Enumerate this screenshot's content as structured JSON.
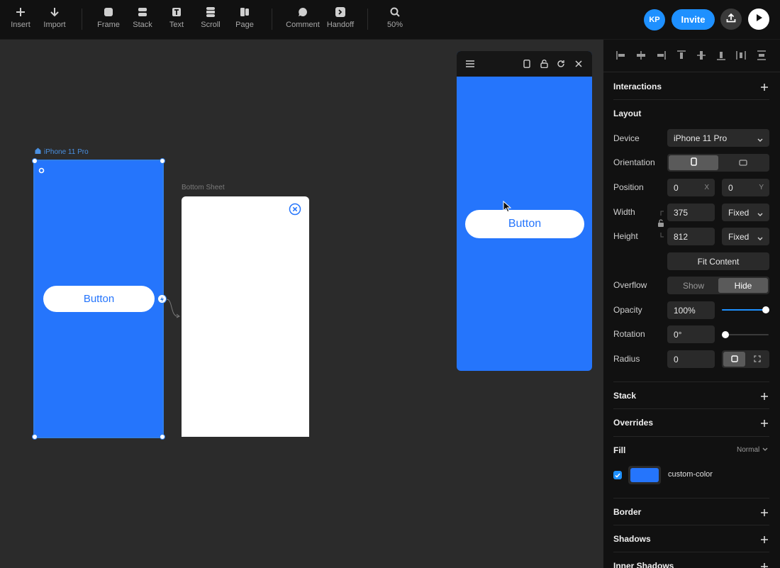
{
  "toolbar": {
    "tools": [
      {
        "label": "Insert",
        "icon": "plus-icon"
      },
      {
        "label": "Import",
        "icon": "arrow-down-icon"
      },
      {
        "label": "Frame",
        "icon": "frame-icon"
      },
      {
        "label": "Stack",
        "icon": "stack-icon"
      },
      {
        "label": "Text",
        "icon": "text-icon"
      },
      {
        "label": "Scroll",
        "icon": "scroll-icon"
      },
      {
        "label": "Page",
        "icon": "page-icon"
      },
      {
        "label": "Comment",
        "icon": "comment-icon"
      },
      {
        "label": "Handoff",
        "icon": "handoff-icon"
      },
      {
        "label": "50%",
        "icon": "zoom-icon"
      }
    ],
    "avatar_initials": "KP",
    "invite_label": "Invite"
  },
  "canvas": {
    "frame1": {
      "label": "iPhone 11 Pro",
      "button_label": "Button"
    },
    "frame2": {
      "label": "Bottom Sheet"
    }
  },
  "preview": {
    "button_label": "Button"
  },
  "panel": {
    "interactions": "Interactions",
    "layout": "Layout",
    "device_label": "Device",
    "device_value": "iPhone 11 Pro",
    "orientation_label": "Orientation",
    "position_label": "Position",
    "position_x": "0",
    "position_x_suffix": "X",
    "position_y": "0",
    "position_y_suffix": "Y",
    "width_label": "Width",
    "width_value": "375",
    "width_mode": "Fixed",
    "height_label": "Height",
    "height_value": "812",
    "height_mode": "Fixed",
    "fit_content": "Fit Content",
    "overflow_label": "Overflow",
    "overflow_show": "Show",
    "overflow_hide": "Hide",
    "opacity_label": "Opacity",
    "opacity_value": "100%",
    "opacity_level": 1.0,
    "rotation_label": "Rotation",
    "rotation_value": "0°",
    "rotation_level": 0.0,
    "radius_label": "Radius",
    "radius_value": "0",
    "stack": "Stack",
    "overrides": "Overrides",
    "fill": "Fill",
    "fill_mode": "Normal",
    "fill_color_name": "custom-color",
    "fill_color": "#2575fc",
    "border": "Border",
    "shadows": "Shadows",
    "inner_shadows": "Inner Shadows"
  },
  "colors": {
    "accent": "#1e90ff",
    "frame_blue": "#2575fc",
    "panel_bg": "#111111",
    "canvas_bg": "#2b2b2b"
  }
}
